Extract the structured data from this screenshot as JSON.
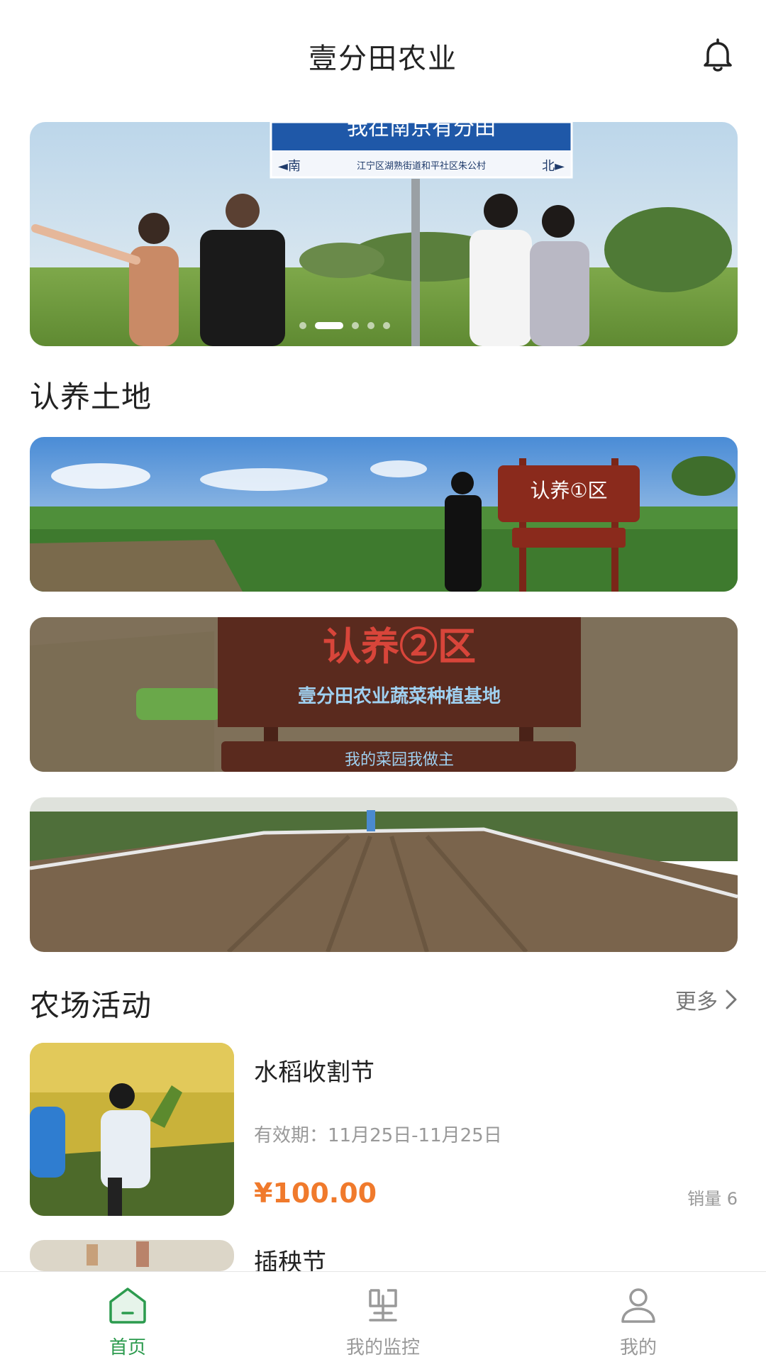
{
  "header": {
    "title": "壹分田农业",
    "bell_icon": "bell-icon"
  },
  "banner": {
    "sign_title": "我在南京有分田",
    "sign_left": "◄南",
    "sign_address": "江宁区湖熟街道和平社区朱公村",
    "sign_right": "北►",
    "slide_count": 5,
    "active_slide": 2
  },
  "adopt": {
    "title": "认养土地",
    "cards": [
      {
        "sign_text": "认养①区"
      },
      {
        "sign_title": "认养②区",
        "sign_subtitle": "壹分田农业蔬菜种植基地",
        "sign_bottom": "我的菜园我做主"
      },
      {}
    ]
  },
  "activities": {
    "title": "农场活动",
    "more_label": "更多",
    "items": [
      {
        "name": "水稻收割节",
        "valid": "有效期：11月25日-11月25日",
        "price": "¥100.00",
        "sales": "销量 6"
      },
      {
        "name": "插秧节"
      }
    ]
  },
  "tabbar": {
    "items": [
      {
        "label": "首页",
        "icon": "home-icon",
        "active": true
      },
      {
        "label": "我的监控",
        "icon": "monitor-icon",
        "active": false
      },
      {
        "label": "我的",
        "icon": "user-icon",
        "active": false
      }
    ]
  },
  "colors": {
    "accent": "#2c9b4e",
    "price": "#f07a2c"
  }
}
